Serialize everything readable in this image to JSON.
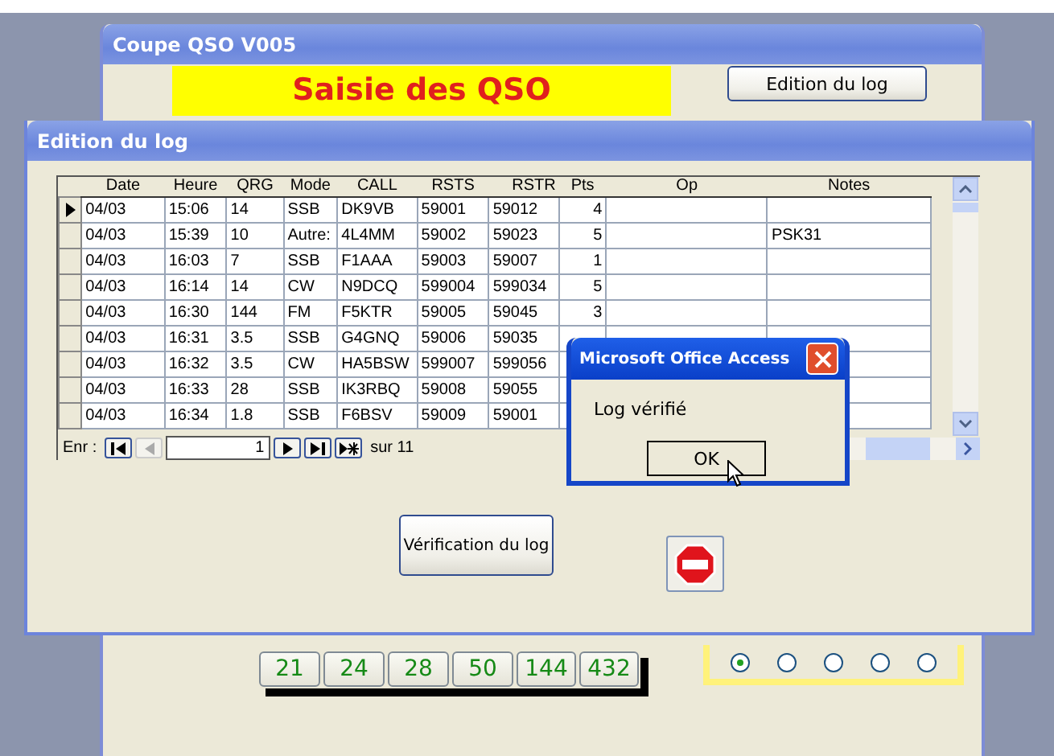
{
  "main_window": {
    "title": "Coupe QSO V005",
    "heading": "Saisie des QSO",
    "edit_button": "Edition du log",
    "band_buttons": [
      "21",
      "24",
      "28",
      "50",
      "144",
      "432"
    ],
    "radios": [
      {
        "selected": true
      },
      {
        "selected": false
      },
      {
        "selected": false
      },
      {
        "selected": false
      },
      {
        "selected": false
      }
    ]
  },
  "log_window": {
    "title": "Edition du log",
    "table": {
      "columns": [
        "Date",
        "Heure",
        "QRG",
        "Mode",
        "CALL",
        "RSTS",
        "RSTR",
        "Pts",
        "Op",
        "Notes"
      ],
      "rows": [
        {
          "current": true,
          "cells": [
            "04/03",
            "15:06",
            "14",
            "SSB",
            "DK9VB",
            "59001",
            "59012",
            "4",
            "",
            ""
          ]
        },
        {
          "current": false,
          "cells": [
            "04/03",
            "15:39",
            "10",
            "Autre:",
            "4L4MM",
            "59002",
            "59023",
            "5",
            "",
            "PSK31"
          ]
        },
        {
          "current": false,
          "cells": [
            "04/03",
            "16:03",
            "7",
            "SSB",
            "F1AAA",
            "59003",
            "59007",
            "1",
            "",
            ""
          ]
        },
        {
          "current": false,
          "cells": [
            "04/03",
            "16:14",
            "14",
            "CW",
            "N9DCQ",
            "599004",
            "599034",
            "5",
            "",
            ""
          ]
        },
        {
          "current": false,
          "cells": [
            "04/03",
            "16:30",
            "144",
            "FM",
            "F5KTR",
            "59005",
            "59045",
            "3",
            "",
            ""
          ]
        },
        {
          "current": false,
          "cells": [
            "04/03",
            "16:31",
            "3.5",
            "SSB",
            "G4GNQ",
            "59006",
            "59035",
            "",
            "",
            ""
          ]
        },
        {
          "current": false,
          "cells": [
            "04/03",
            "16:32",
            "3.5",
            "CW",
            "HA5BSW",
            "599007",
            "599056",
            "",
            "",
            ""
          ]
        },
        {
          "current": false,
          "cells": [
            "04/03",
            "16:33",
            "28",
            "SSB",
            "IK3RBQ",
            "59008",
            "59055",
            "",
            "",
            ""
          ]
        },
        {
          "current": false,
          "cells": [
            "04/03",
            "16:34",
            "1.8",
            "SSB",
            "F6BSV",
            "59009",
            "59001",
            "",
            "",
            ""
          ]
        }
      ]
    },
    "navigator": {
      "label": "Enr :",
      "record": "1",
      "total": "sur 11"
    },
    "verify_button": "Vérification du log"
  },
  "dialog": {
    "title": "Microsoft Office Access",
    "message": "Log vérifié",
    "ok_button": "OK"
  }
}
